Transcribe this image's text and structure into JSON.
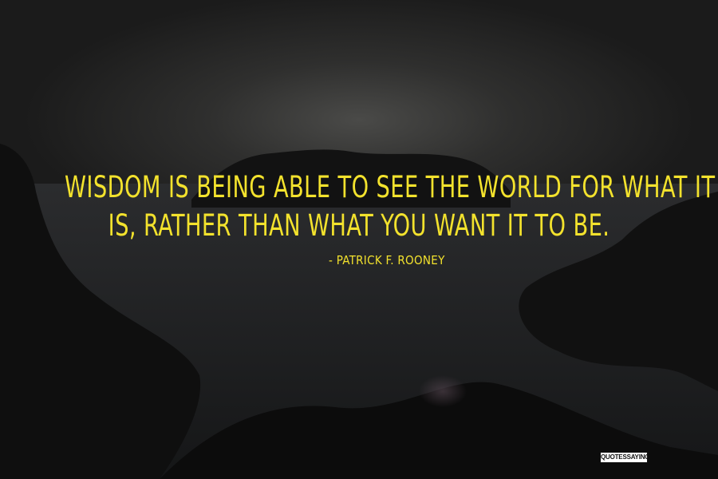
{
  "quote": {
    "line1": "Wisdom is being able to see the world for what it",
    "line2": "is, rather than what you want it to be."
  },
  "author": "- Patrick F. Rooney",
  "watermark": "QUOTESSAYINGS.NET",
  "colors": {
    "text": "#f3e22d",
    "background": "#1b1b1b"
  }
}
